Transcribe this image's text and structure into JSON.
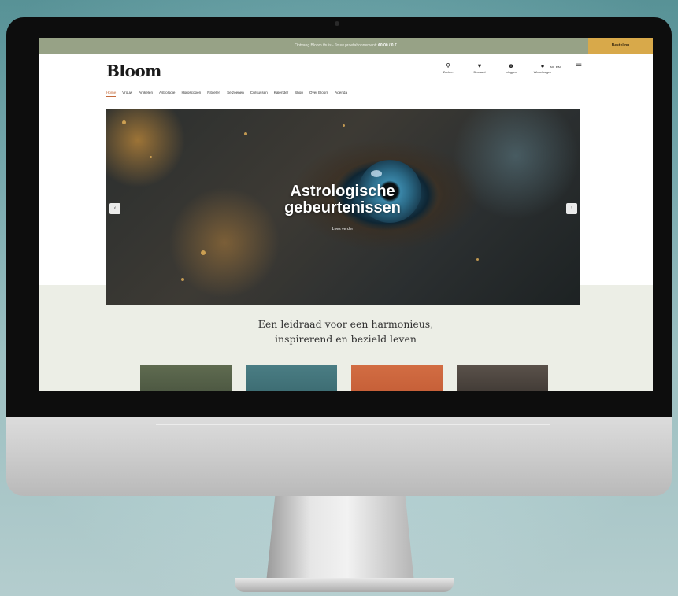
{
  "topbar": {
    "text": "Ontvang Bloom thuis - Jouw proefabonnement:",
    "link": "€0,00 / 0 €",
    "cta": "Bestel nu"
  },
  "header": {
    "logo": "Bloom",
    "logo_sub": "",
    "icons": [
      {
        "icon": "search-icon",
        "label": "Zoeken"
      },
      {
        "icon": "bookmark-icon",
        "label": "Bewaard"
      },
      {
        "icon": "account-icon",
        "label": "Inloggen"
      },
      {
        "icon": "cart-icon",
        "label": "Winkelwagen"
      }
    ],
    "lang": "NL EN",
    "menu_icon": "menu-icon"
  },
  "nav": {
    "items": [
      "Home",
      "Vrouw",
      "Artikelen",
      "Astrologie",
      "Horoscopen",
      "Rituelen",
      "Seizoenen",
      "Cursussen",
      "Kalender",
      "Shop",
      "Over Bloom",
      "Agenda"
    ],
    "active_index": 0
  },
  "hero": {
    "title": "Astrologische gebeurtenissen",
    "link": "Lees verder",
    "prev_icon": "chevron-left-icon",
    "next_icon": "chevron-right-icon"
  },
  "tagline": {
    "line1": "Een leidraad voor een harmonieus,",
    "line2": "inspirerend en bezield leven"
  },
  "colors": {
    "topbar": "#97a286",
    "cta": "#d8a94a",
    "nav_active": "#c46a3a",
    "band": "#eceee6"
  }
}
